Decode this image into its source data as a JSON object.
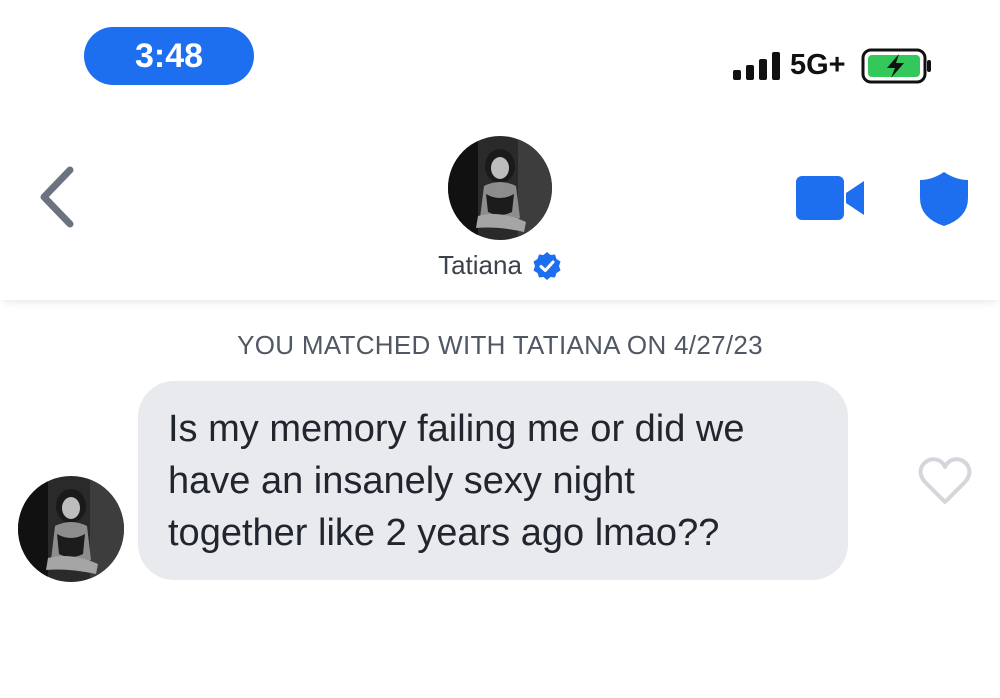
{
  "status_bar": {
    "time": "3:48",
    "network": "5G+",
    "icons": [
      "signal-bars-icon",
      "battery-charging-icon"
    ]
  },
  "header": {
    "contact_name": "Tatiana",
    "verified": true,
    "icons": [
      "back-chevron-icon",
      "video-call-icon",
      "safety-shield-icon",
      "verified-badge-icon"
    ],
    "accent_color": "#1d6ff0"
  },
  "conversation": {
    "match_note": "YOU MATCHED WITH TATIANA ON 4/27/23",
    "messages": [
      {
        "sender": "Tatiana",
        "lines": [
          "Is my memory failing me or did we",
          "have an insanely sexy night",
          "together like 2 years ago lmao??"
        ]
      }
    ],
    "bubble_color": "#e9eaee"
  }
}
